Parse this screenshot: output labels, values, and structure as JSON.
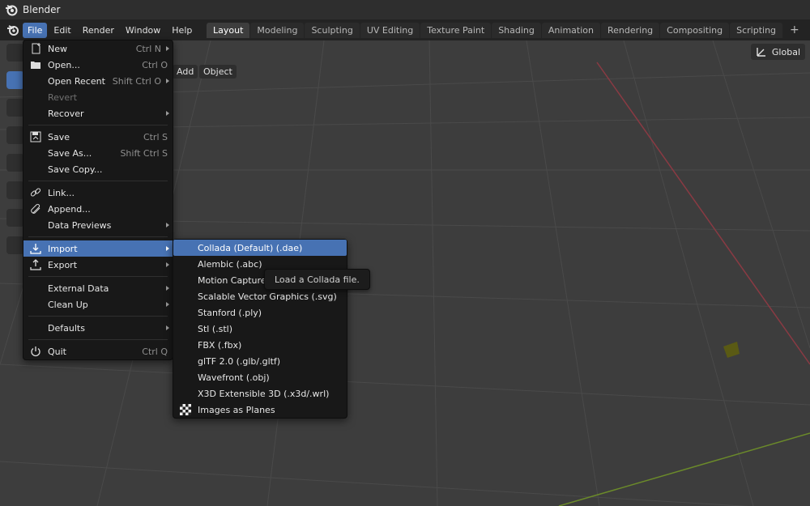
{
  "app": {
    "title": "Blender"
  },
  "menubar": {
    "items": [
      "File",
      "Edit",
      "Render",
      "Window",
      "Help"
    ]
  },
  "workspaces": {
    "tabs": [
      "Layout",
      "Modeling",
      "Sculpting",
      "UV Editing",
      "Texture Paint",
      "Shading",
      "Animation",
      "Rendering",
      "Compositing",
      "Scripting"
    ],
    "active": "Layout",
    "add": "+"
  },
  "viewport": {
    "header_add": "Add",
    "header_object": "Object",
    "orientation": "Global"
  },
  "file_menu": {
    "new": {
      "label": "New",
      "shortcut": "Ctrl N"
    },
    "open": {
      "label": "Open...",
      "shortcut": "Ctrl O"
    },
    "open_recent": {
      "label": "Open Recent",
      "shortcut": "Shift Ctrl O"
    },
    "revert": {
      "label": "Revert"
    },
    "recover": {
      "label": "Recover"
    },
    "save": {
      "label": "Save",
      "shortcut": "Ctrl S"
    },
    "save_as": {
      "label": "Save As...",
      "shortcut": "Shift Ctrl S"
    },
    "save_copy": {
      "label": "Save Copy..."
    },
    "link": {
      "label": "Link..."
    },
    "append": {
      "label": "Append..."
    },
    "data_previews": {
      "label": "Data Previews"
    },
    "import": {
      "label": "Import"
    },
    "export": {
      "label": "Export"
    },
    "external_data": {
      "label": "External Data"
    },
    "clean_up": {
      "label": "Clean Up"
    },
    "defaults": {
      "label": "Defaults"
    },
    "quit": {
      "label": "Quit",
      "shortcut": "Ctrl Q"
    }
  },
  "import_menu": {
    "items": [
      "Collada (Default) (.dae)",
      "Alembic (.abc)",
      "Motion Capture (",
      "Scalable Vector Graphics (.svg)",
      "Stanford (.ply)",
      "Stl (.stl)",
      "FBX (.fbx)",
      "glTF 2.0 (.glb/.gltf)",
      "Wavefront (.obj)",
      "X3D Extensible 3D (.x3d/.wrl)",
      "Images as Planes"
    ]
  },
  "tooltip": {
    "text": "Load a Collada file."
  }
}
